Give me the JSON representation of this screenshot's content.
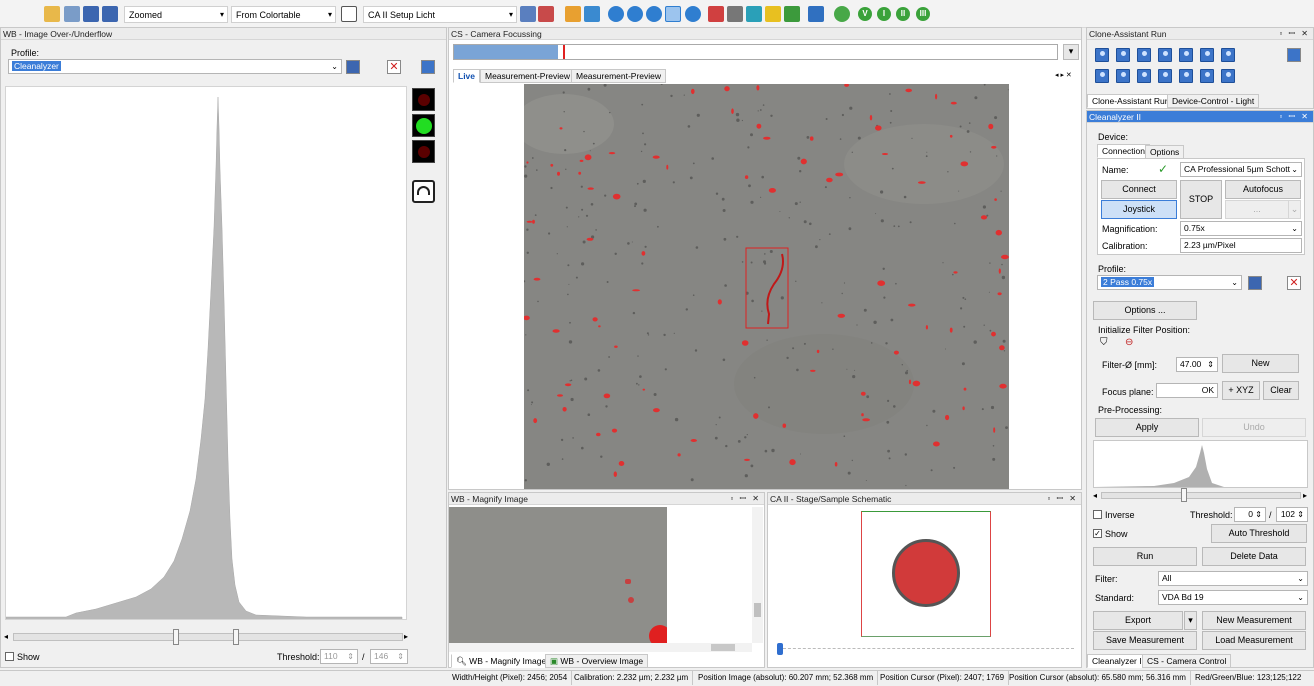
{
  "toolbar": {
    "view_mode": "Zoomed",
    "color_mode": "From Colortable",
    "setup_profile": "CA II Setup Licht",
    "status_circles": [
      "V",
      "I",
      "II",
      "III"
    ]
  },
  "left_panel": {
    "title": "WB - Image Over-/Underflow",
    "profile_label": "Profile:",
    "profile_value": "Cleanalyzer",
    "show_label": "Show",
    "threshold_label": "Threshold:",
    "threshold_low": "110",
    "threshold_high": "146",
    "threshold_sep": "/"
  },
  "camera_panel": {
    "title": "CS - Camera Focussing",
    "tabs": [
      "Live",
      "Measurement-Preview",
      "Measurement-Preview"
    ],
    "focus_level": 0.26
  },
  "magnify_panel": {
    "title": "WB - Magnify Image",
    "bottom_tabs": [
      "WB - Magnify Image",
      "WB - Overview Image"
    ]
  },
  "stage_panel": {
    "title": "CA II - Stage/Sample Schematic"
  },
  "clone_panel": {
    "title": "Clone-Assistant Run",
    "tabs": [
      "Clone-Assistant Run",
      "Device-Control - Light"
    ]
  },
  "cleanalyzer": {
    "title": "Cleanalyzer II",
    "device_label": "Device:",
    "tabs": [
      "Connection",
      "Options"
    ],
    "name_label": "Name:",
    "name_value": "CA Professional 5µm Schott",
    "connect": "Connect",
    "stop": "STOP",
    "autofocus": "Autofocus",
    "joystick": "Joystick",
    "dots": "...",
    "magnification_label": "Magnification:",
    "magnification_value": "0.75x",
    "calibration_label": "Calibration:",
    "calibration_value": "2.23 µm/Pixel",
    "profile_label": "Profile:",
    "profile_value": "2 Pass 0.75x",
    "options_button": "Options ...",
    "init_filter_label": "Initialize Filter Position:",
    "filter_diam_label": "Filter-Ø [mm]:",
    "filter_diam_value": "47.00",
    "new_button": "New",
    "focus_plane_label": "Focus plane:",
    "ok_button": "OK",
    "xyz_button": "+ XYZ",
    "clear_button": "Clear",
    "preprocessing_label": "Pre-Processing:",
    "apply_button": "Apply",
    "undo_button": "Undo",
    "inverse_label": "Inverse",
    "threshold_label": "Threshold:",
    "threshold_low": "0",
    "threshold_high": "102",
    "threshold_sep": "/",
    "show_label": "Show",
    "auto_threshold": "Auto Threshold",
    "run_button": "Run",
    "delete_data": "Delete Data",
    "filter_label": "Filter:",
    "filter_value": "All",
    "standard_label": "Standard:",
    "standard_value": "VDA Bd 19",
    "export_button": "Export",
    "new_measurement": "New Measurement",
    "save_measurement": "Save Measurement",
    "load_measurement": "Load Measurement",
    "bottom_tabs": [
      "Cleanalyzer II",
      "CS - Camera Control"
    ]
  },
  "statusbar": [
    "Width/Height (Pixel): 2456; 2054",
    "Calibration: 2.232 µm; 2.232 µm",
    "Position Image (absolut): 60.207 mm; 52.368 mm",
    "Position Cursor (Pixel): 2407; 1769",
    "Position Cursor (absolut): 65.580 mm; 56.316 mm",
    "Red/Green/Blue: 123;125;122"
  ],
  "colors": {
    "accent": "#3b7dd8",
    "particle_red": "#e03030",
    "lamp_green": "#22dd22"
  }
}
